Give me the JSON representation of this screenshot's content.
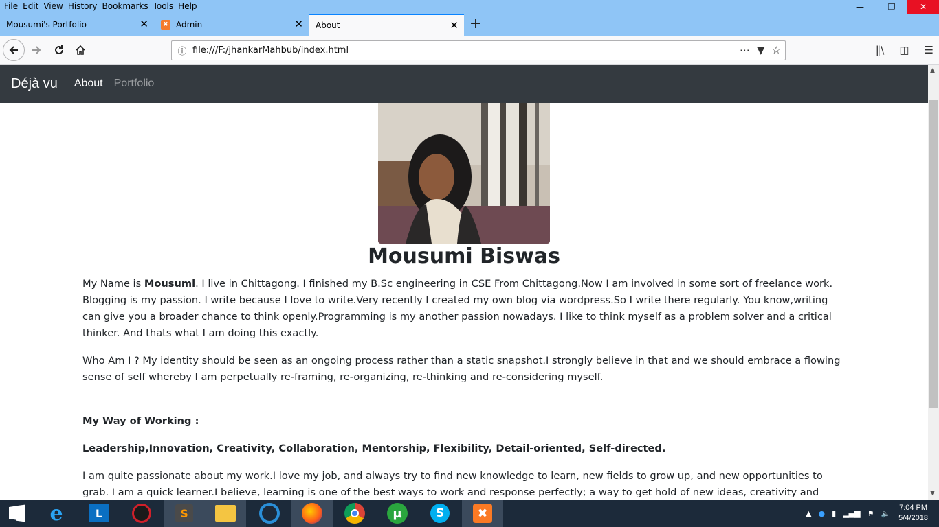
{
  "menubar": {
    "items": [
      {
        "label": "File",
        "ul": "F",
        "rest": "ile"
      },
      {
        "label": "Edit",
        "ul": "E",
        "rest": "dit"
      },
      {
        "label": "View",
        "ul": "V",
        "rest": "iew"
      },
      {
        "label": "History",
        "ul": "",
        "rest": "History"
      },
      {
        "label": "Bookmarks",
        "ul": "B",
        "rest": "ookmarks"
      },
      {
        "label": "Tools",
        "ul": "T",
        "rest": "ools"
      },
      {
        "label": "Help",
        "ul": "H",
        "rest": "elp"
      }
    ]
  },
  "tabs": [
    {
      "title": "Mousumi's Portfolio",
      "active": false
    },
    {
      "title": "Admin",
      "active": false,
      "favicon": "xampp-icon"
    },
    {
      "title": "About",
      "active": true
    }
  ],
  "urlbar": {
    "url": "file:///F:/jhankarMahbub/index.html"
  },
  "site": {
    "brand": "Déjà vu",
    "nav": [
      {
        "label": "About",
        "active": true
      },
      {
        "label": "Portfolio",
        "active": false
      }
    ],
    "name": "Mousumi Biswas",
    "intro_prefix": "My Name is ",
    "intro_bold": "Mousumi",
    "intro_rest": ". I live in Chittagong. I finished my B.Sc engineering in CSE From Chittagong.Now I am involved in some sort of freelance work. Blogging is my passion. I write because I love to write.Very recently I created my own blog via wordpress.So I write there regularly. You know,writing can give you a broader chance to think openly.Programming is my another passion nowadays. I like to think myself as a problem solver and a critical thinker. And thats what I am doing this exactly.",
    "who_am_i": "Who Am I ? My identity should be seen as an ongoing process rather than a static snapshot.I strongly believe in that and we should embrace a flowing sense of self whereby I am perpetually re-framing, re-organizing, re-thinking and re-considering myself.",
    "way_heading": "My Way of Working :",
    "way_list": "Leadership,Innovation, Creativity, Collaboration, Mentorship, Flexibility, Detail-oriented, Self-directed.",
    "passion": "I am quite passionate about my work.I love my job, and always try to find new knowledge to learn, new fields to grow up, and new opportunities to grab. I am a quick learner.I believe, learning is one of the best ways to work and response perfectly; a way to get hold of new ideas, creativity and innovation. I"
  },
  "taskbar": {
    "time": "7:04 PM",
    "date": "5/4/2018"
  },
  "colors": {
    "titlebar": "#8fc5f6",
    "navbar": "#343a40",
    "taskbar": "#1c2a3a",
    "close": "#e81123"
  }
}
